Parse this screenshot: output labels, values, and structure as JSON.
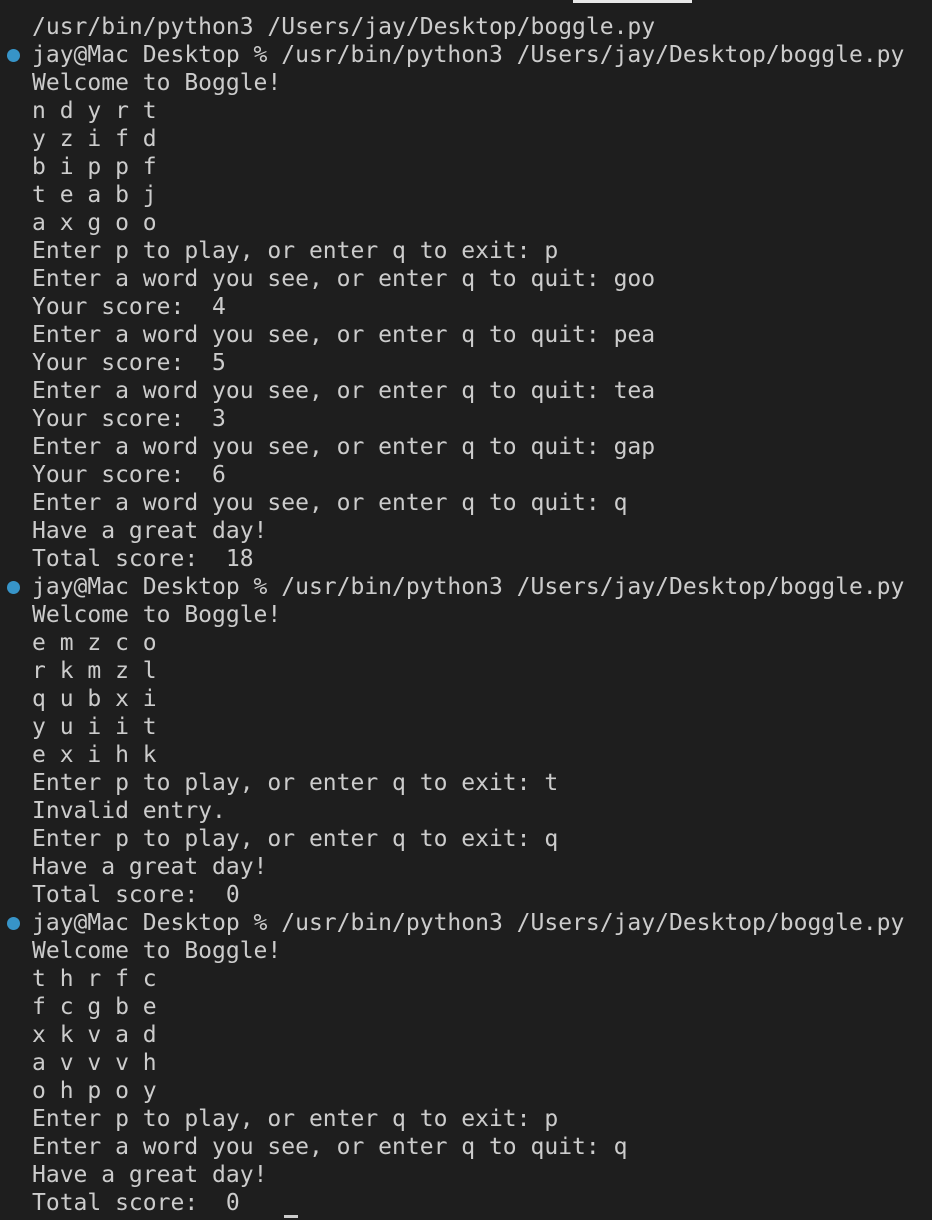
{
  "terminal": {
    "lines": [
      {
        "text": "/usr/bin/python3 /Users/jay/Desktop/boggle.py",
        "marker": false
      },
      {
        "text": "jay@Mac Desktop % /usr/bin/python3 /Users/jay/Desktop/boggle.py",
        "marker": true
      },
      {
        "text": "Welcome to Boggle!",
        "marker": false
      },
      {
        "text": "n d y r t",
        "marker": false
      },
      {
        "text": "y z i f d",
        "marker": false
      },
      {
        "text": "b i p p f",
        "marker": false
      },
      {
        "text": "t e a b j",
        "marker": false
      },
      {
        "text": "a x g o o",
        "marker": false
      },
      {
        "text": "Enter p to play, or enter q to exit: p",
        "marker": false
      },
      {
        "text": "Enter a word you see, or enter q to quit: goo",
        "marker": false
      },
      {
        "text": "Your score:  4",
        "marker": false
      },
      {
        "text": "Enter a word you see, or enter q to quit: pea",
        "marker": false
      },
      {
        "text": "Your score:  5",
        "marker": false
      },
      {
        "text": "Enter a word you see, or enter q to quit: tea",
        "marker": false
      },
      {
        "text": "Your score:  3",
        "marker": false
      },
      {
        "text": "Enter a word you see, or enter q to quit: gap",
        "marker": false
      },
      {
        "text": "Your score:  6",
        "marker": false
      },
      {
        "text": "Enter a word you see, or enter q to quit: q",
        "marker": false
      },
      {
        "text": "Have a great day!",
        "marker": false
      },
      {
        "text": "Total score:  18",
        "marker": false
      },
      {
        "text": "jay@Mac Desktop % /usr/bin/python3 /Users/jay/Desktop/boggle.py",
        "marker": true
      },
      {
        "text": "Welcome to Boggle!",
        "marker": false
      },
      {
        "text": "e m z c o",
        "marker": false
      },
      {
        "text": "r k m z l",
        "marker": false
      },
      {
        "text": "q u b x i",
        "marker": false
      },
      {
        "text": "y u i i t",
        "marker": false
      },
      {
        "text": "e x i h k",
        "marker": false
      },
      {
        "text": "Enter p to play, or enter q to exit: t",
        "marker": false
      },
      {
        "text": "Invalid entry.",
        "marker": false
      },
      {
        "text": "Enter p to play, or enter q to exit: q",
        "marker": false
      },
      {
        "text": "Have a great day!",
        "marker": false
      },
      {
        "text": "Total score:  0",
        "marker": false
      },
      {
        "text": "jay@Mac Desktop % /usr/bin/python3 /Users/jay/Desktop/boggle.py",
        "marker": true
      },
      {
        "text": "Welcome to Boggle!",
        "marker": false
      },
      {
        "text": "t h r f c",
        "marker": false
      },
      {
        "text": "f c g b e",
        "marker": false
      },
      {
        "text": "x k v a d",
        "marker": false
      },
      {
        "text": "a v v v h",
        "marker": false
      },
      {
        "text": "o h p o y",
        "marker": false
      },
      {
        "text": "Enter p to play, or enter q to exit: p",
        "marker": false
      },
      {
        "text": "Enter a word you see, or enter q to quit: q",
        "marker": false
      },
      {
        "text": "Have a great day!",
        "marker": false
      },
      {
        "text": "Total score:  0",
        "marker": false
      }
    ]
  },
  "colors": {
    "background": "#1e1e1e",
    "text": "#cccccc",
    "command_marker": "#3794c8"
  },
  "icons": {
    "command_marker": "command-decoration-dot-icon",
    "cursor": "text-cursor-icon"
  }
}
